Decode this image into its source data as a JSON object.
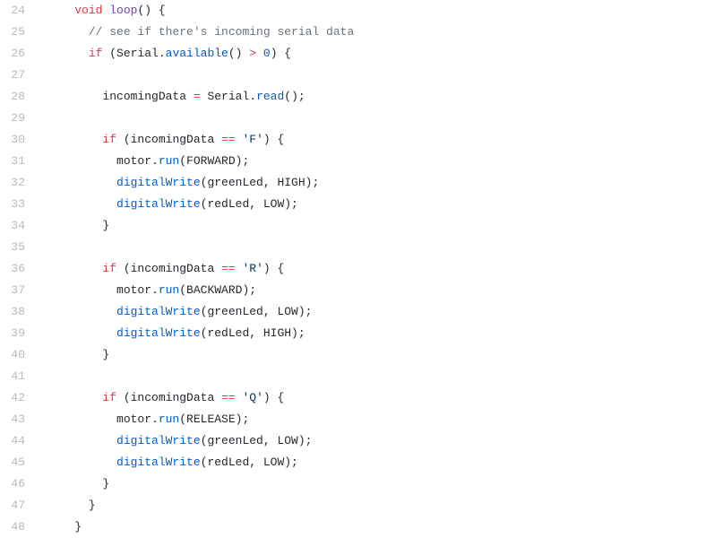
{
  "lines": [
    {
      "n": 24,
      "tokens": [
        {
          "t": "    ",
          "c": ""
        },
        {
          "t": "void",
          "c": "kw-type"
        },
        {
          "t": " ",
          "c": ""
        },
        {
          "t": "loop",
          "c": "fn-def"
        },
        {
          "t": "() {",
          "c": "punct"
        }
      ]
    },
    {
      "n": 25,
      "tokens": [
        {
          "t": "      ",
          "c": ""
        },
        {
          "t": "// see if there's incoming serial data",
          "c": "cmt"
        }
      ]
    },
    {
      "n": 26,
      "tokens": [
        {
          "t": "      ",
          "c": ""
        },
        {
          "t": "if",
          "c": "kw-ctrl"
        },
        {
          "t": " (Serial.",
          "c": "punct"
        },
        {
          "t": "available",
          "c": "fn-call"
        },
        {
          "t": "() ",
          "c": "punct"
        },
        {
          "t": ">",
          "c": "op"
        },
        {
          "t": " ",
          "c": ""
        },
        {
          "t": "0",
          "c": "num"
        },
        {
          "t": ") {",
          "c": "punct"
        }
      ]
    },
    {
      "n": 27,
      "tokens": []
    },
    {
      "n": 28,
      "tokens": [
        {
          "t": "        incomingData ",
          "c": "ident"
        },
        {
          "t": "=",
          "c": "op"
        },
        {
          "t": " Serial.",
          "c": "punct"
        },
        {
          "t": "read",
          "c": "fn-call"
        },
        {
          "t": "();",
          "c": "punct"
        }
      ]
    },
    {
      "n": 29,
      "tokens": []
    },
    {
      "n": 30,
      "tokens": [
        {
          "t": "        ",
          "c": ""
        },
        {
          "t": "if",
          "c": "kw-ctrl"
        },
        {
          "t": " (incomingData ",
          "c": "punct"
        },
        {
          "t": "==",
          "c": "op"
        },
        {
          "t": " ",
          "c": ""
        },
        {
          "t": "'F'",
          "c": "str"
        },
        {
          "t": ") {",
          "c": "punct"
        }
      ]
    },
    {
      "n": 31,
      "tokens": [
        {
          "t": "          motor.",
          "c": "ident"
        },
        {
          "t": "run",
          "c": "fn-call"
        },
        {
          "t": "(FORWARD);",
          "c": "punct"
        }
      ]
    },
    {
      "n": 32,
      "tokens": [
        {
          "t": "          ",
          "c": ""
        },
        {
          "t": "digitalWrite",
          "c": "fn-call"
        },
        {
          "t": "(greenLed, HIGH);",
          "c": "punct"
        }
      ]
    },
    {
      "n": 33,
      "tokens": [
        {
          "t": "          ",
          "c": ""
        },
        {
          "t": "digitalWrite",
          "c": "fn-call"
        },
        {
          "t": "(redLed, LOW);",
          "c": "punct"
        }
      ]
    },
    {
      "n": 34,
      "tokens": [
        {
          "t": "        }",
          "c": "punct"
        }
      ]
    },
    {
      "n": 35,
      "tokens": []
    },
    {
      "n": 36,
      "tokens": [
        {
          "t": "        ",
          "c": ""
        },
        {
          "t": "if",
          "c": "kw-ctrl"
        },
        {
          "t": " (incomingData ",
          "c": "punct"
        },
        {
          "t": "==",
          "c": "op"
        },
        {
          "t": " ",
          "c": ""
        },
        {
          "t": "'R'",
          "c": "str"
        },
        {
          "t": ") {",
          "c": "punct"
        }
      ]
    },
    {
      "n": 37,
      "tokens": [
        {
          "t": "          motor.",
          "c": "ident"
        },
        {
          "t": "run",
          "c": "fn-call"
        },
        {
          "t": "(BACKWARD);",
          "c": "punct"
        }
      ]
    },
    {
      "n": 38,
      "tokens": [
        {
          "t": "          ",
          "c": ""
        },
        {
          "t": "digitalWrite",
          "c": "fn-call"
        },
        {
          "t": "(greenLed, LOW);",
          "c": "punct"
        }
      ]
    },
    {
      "n": 39,
      "tokens": [
        {
          "t": "          ",
          "c": ""
        },
        {
          "t": "digitalWrite",
          "c": "fn-call"
        },
        {
          "t": "(redLed, HIGH);",
          "c": "punct"
        }
      ]
    },
    {
      "n": 40,
      "tokens": [
        {
          "t": "        }",
          "c": "punct"
        }
      ]
    },
    {
      "n": 41,
      "tokens": []
    },
    {
      "n": 42,
      "tokens": [
        {
          "t": "        ",
          "c": ""
        },
        {
          "t": "if",
          "c": "kw-ctrl"
        },
        {
          "t": " (incomingData ",
          "c": "punct"
        },
        {
          "t": "==",
          "c": "op"
        },
        {
          "t": " ",
          "c": ""
        },
        {
          "t": "'Q'",
          "c": "str"
        },
        {
          "t": ") {",
          "c": "punct"
        }
      ]
    },
    {
      "n": 43,
      "tokens": [
        {
          "t": "          motor.",
          "c": "ident"
        },
        {
          "t": "run",
          "c": "fn-call"
        },
        {
          "t": "(RELEASE);",
          "c": "punct"
        }
      ]
    },
    {
      "n": 44,
      "tokens": [
        {
          "t": "          ",
          "c": ""
        },
        {
          "t": "digitalWrite",
          "c": "fn-call"
        },
        {
          "t": "(greenLed, LOW);",
          "c": "punct"
        }
      ]
    },
    {
      "n": 45,
      "tokens": [
        {
          "t": "          ",
          "c": ""
        },
        {
          "t": "digitalWrite",
          "c": "fn-call"
        },
        {
          "t": "(redLed, LOW);",
          "c": "punct"
        }
      ]
    },
    {
      "n": 46,
      "tokens": [
        {
          "t": "        }",
          "c": "punct"
        }
      ]
    },
    {
      "n": 47,
      "tokens": [
        {
          "t": "      }",
          "c": "punct"
        }
      ]
    },
    {
      "n": 48,
      "tokens": [
        {
          "t": "    }",
          "c": "punct"
        }
      ]
    }
  ]
}
